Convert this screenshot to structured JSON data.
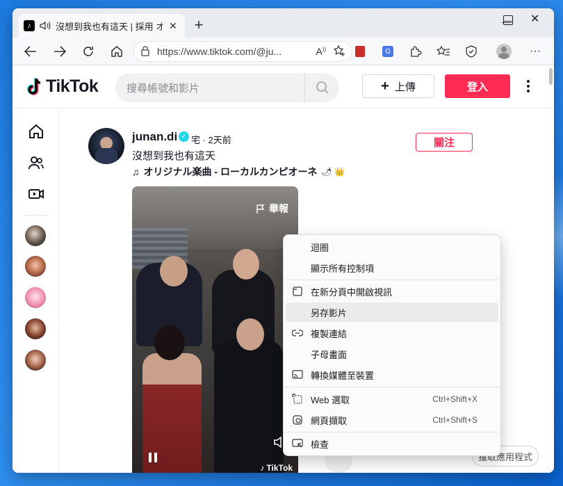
{
  "browser": {
    "tab_title": "沒想到我也有這天 | 採用 オ",
    "url": "https://www.tiktok.com/@ju...",
    "new_tab": "+",
    "win_min": "—",
    "win_max": "☐",
    "win_close": "✕",
    "more": "···"
  },
  "header": {
    "logo": "TikTok",
    "search_placeholder": "搜尋帳號和影片",
    "upload_label": "上傳",
    "login_label": "登入"
  },
  "post": {
    "username": "junan.di",
    "nick_date": "宅 · 2天前",
    "caption": "沒想到我也有這天",
    "music": "オリジナル楽曲 - ローカルカンピオーネ",
    "music_suffix": "🌶 👑",
    "follow_label": "關注",
    "report_label": "舉報",
    "watermark": "TikTok"
  },
  "get_app_label": "獲取應用程式",
  "context_menu": {
    "items": [
      {
        "label": "迴圈",
        "icon": "",
        "shortcut": ""
      },
      {
        "label": "顯示所有控制項",
        "icon": "",
        "shortcut": ""
      },
      {
        "label": "在新分頁中開啟視訊",
        "icon": "new-tab-icon",
        "shortcut": ""
      },
      {
        "label": "另存影片",
        "icon": "",
        "shortcut": ""
      },
      {
        "label": "複製連結",
        "icon": "link-icon",
        "shortcut": ""
      },
      {
        "label": "子母畫面",
        "icon": "",
        "shortcut": ""
      },
      {
        "label": "轉換媒體至裝置",
        "icon": "cast-icon",
        "shortcut": ""
      },
      {
        "label": "Web 選取",
        "icon": "web-select-icon",
        "shortcut": "Ctrl+Shift+X"
      },
      {
        "label": "網頁擷取",
        "icon": "screenshot-icon",
        "shortcut": "Ctrl+Shift+S"
      },
      {
        "label": "檢查",
        "icon": "inspect-icon",
        "shortcut": ""
      }
    ]
  },
  "colors": {
    "brand": "#fe2c55",
    "verified": "#20d5ec",
    "desktop": "#1c7be0"
  }
}
